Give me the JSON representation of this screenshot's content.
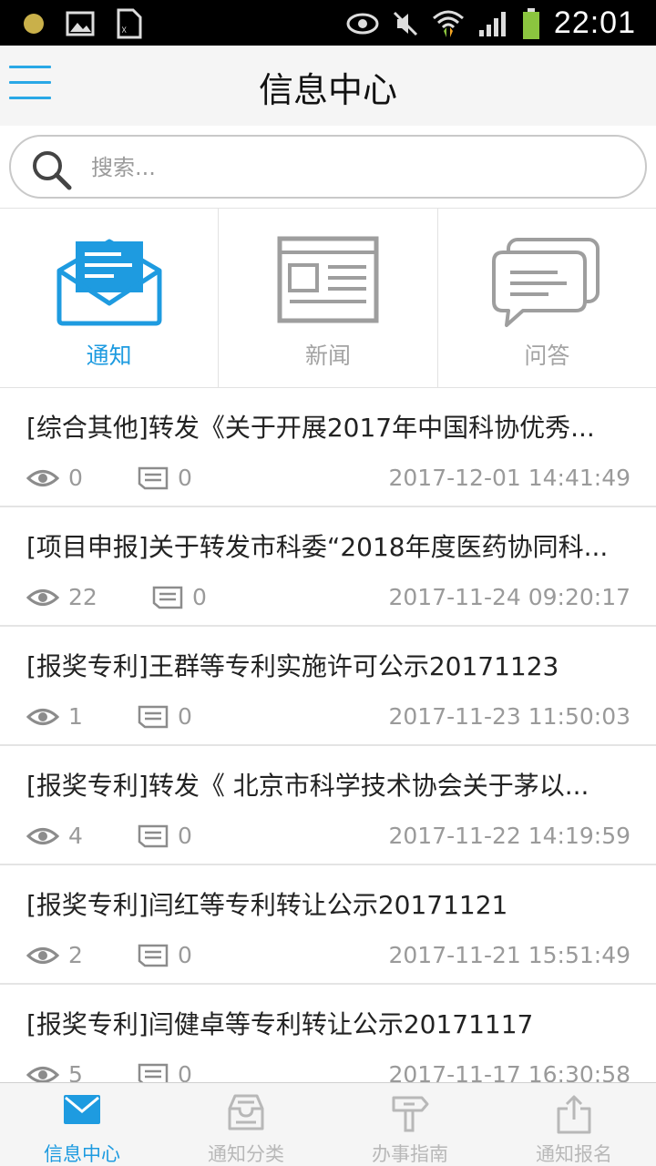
{
  "status_bar": {
    "time": "22:01"
  },
  "header": {
    "title": "信息中心"
  },
  "search": {
    "placeholder": "搜索..."
  },
  "categories": [
    {
      "label": "通知",
      "icon": "envelope-icon",
      "active": true
    },
    {
      "label": "新闻",
      "icon": "newspaper-icon",
      "active": false
    },
    {
      "label": "问答",
      "icon": "chat-bubbles-icon",
      "active": false
    }
  ],
  "items": [
    {
      "title": "[综合其他]转发《关于开展2017年中国科协优秀...",
      "views": "0",
      "comments": "0",
      "date": "2017-12-01 14:41:49"
    },
    {
      "title": "[项目申报]关于转发市科委“2018年度医药协同科...",
      "views": "22",
      "comments": "0",
      "date": "2017-11-24 09:20:17"
    },
    {
      "title": "[报奖专利]王群等专利实施许可公示20171123",
      "views": "1",
      "comments": "0",
      "date": "2017-11-23 11:50:03"
    },
    {
      "title": "[报奖专利]转发《 北京市科学技术协会关于茅以...",
      "views": "4",
      "comments": "0",
      "date": "2017-11-22 14:19:59"
    },
    {
      "title": "[报奖专利]闫红等专利转让公示20171121",
      "views": "2",
      "comments": "0",
      "date": "2017-11-21 15:51:49"
    },
    {
      "title": "[报奖专利]闫健卓等专利转让公示20171117",
      "views": "5",
      "comments": "0",
      "date": "2017-11-17 16:30:58"
    }
  ],
  "bottom_nav": [
    {
      "label": "信息中心",
      "icon": "mail-icon",
      "active": true
    },
    {
      "label": "通知分类",
      "icon": "inbox-tray-icon",
      "active": false
    },
    {
      "label": "办事指南",
      "icon": "signpost-icon",
      "active": false
    },
    {
      "label": "通知报名",
      "icon": "share-upload-icon",
      "active": false
    }
  ],
  "colors": {
    "accent": "#1e9be0",
    "inactive": "#a3a3a3"
  }
}
